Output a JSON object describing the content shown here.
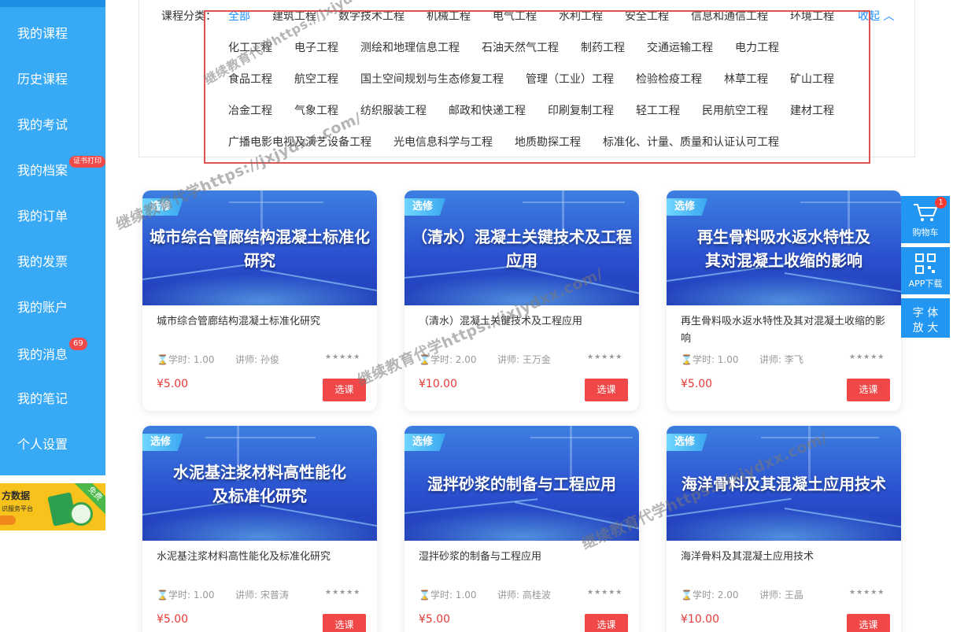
{
  "sidebar": {
    "items": [
      {
        "label": "我的课程"
      },
      {
        "label": "历史课程"
      },
      {
        "label": "我的考试"
      },
      {
        "label": "我的档案",
        "badge": "证书打印"
      },
      {
        "label": "我的订单"
      },
      {
        "label": "我的发票"
      },
      {
        "label": "我的账户"
      },
      {
        "label": "我的消息",
        "badge": "69"
      },
      {
        "label": "我的笔记"
      },
      {
        "label": "个人设置"
      }
    ],
    "promo": {
      "title": "方数据",
      "subtitle": "识服务平台",
      "ribbon": "免费"
    }
  },
  "filter": {
    "label": "课程分类：",
    "collapse_label": "收起",
    "row0": [
      "全部",
      "建筑工程",
      "数字技术工程",
      "机械工程",
      "电气工程",
      "水利工程",
      "安全工程",
      "信息和通信工程",
      "环境工程"
    ],
    "row1": [
      "化工工程",
      "电子工程",
      "测绘和地理信息工程",
      "石油天然气工程",
      "制药工程",
      "交通运输工程",
      "电力工程"
    ],
    "row2": [
      "食品工程",
      "航空工程",
      "国土空间规划与生态修复工程",
      "管理（工业）工程",
      "检验检疫工程",
      "林草工程",
      "矿山工程"
    ],
    "row3": [
      "冶金工程",
      "气象工程",
      "纺织服装工程",
      "邮政和快递工程",
      "印刷复制工程",
      "轻工工程",
      "民用航空工程",
      "建材工程"
    ],
    "row4": [
      "广播电影电视及演艺设备工程",
      "光电信息科学与工程",
      "地质勘探工程",
      "标准化、计量、质量和认证认可工程"
    ]
  },
  "courses": [
    {
      "tag": "选修",
      "banner_title": "城市综合管廊结构混凝土标准化研究",
      "title": "城市综合管廊结构混凝土标准化研究",
      "hours": "学时: 1.00",
      "teacher": "讲师: 孙俊",
      "stars": "★★★★★",
      "price": "¥5.00",
      "button": "选课"
    },
    {
      "tag": "选修",
      "banner_title": "（清水）混凝土关键技术及工程应用",
      "title": "（清水）混凝土关键技术及工程应用",
      "hours": "学时: 2.00",
      "teacher": "讲师: 王万金",
      "stars": "★★★★★",
      "price": "¥10.00",
      "button": "选课"
    },
    {
      "tag": "选修",
      "banner_title": "再生骨料吸水返水特性及其对混凝土收缩的影响",
      "title": "再生骨料吸水返水特性及其对混凝土收缩的影响",
      "hours": "学时: 1.00",
      "teacher": "讲师: 李飞",
      "stars": "★★★★★",
      "price": "¥5.00",
      "button": "选课"
    },
    {
      "tag": "选修",
      "banner_title": "水泥基注浆材料高性能化及标准化研究",
      "title": "水泥基注浆材料高性能化及标准化研究",
      "hours": "学时: 1.00",
      "teacher": "讲师: 宋普涛",
      "stars": "★★★★★",
      "price": "¥5.00",
      "button": "选课"
    },
    {
      "tag": "选修",
      "banner_title": "湿拌砂浆的制备与工程应用",
      "title": "湿拌砂浆的制备与工程应用",
      "hours": "学时: 1.00",
      "teacher": "讲师: 高桂波",
      "stars": "★★★★★",
      "price": "¥5.00",
      "button": "选课"
    },
    {
      "tag": "选修",
      "banner_title": "海洋骨料及其混凝土应用技术",
      "title": "海洋骨料及其混凝土应用技术",
      "hours": "学时: 2.00",
      "teacher": "讲师: 王晶",
      "stars": "★★★★★",
      "price": "¥10.00",
      "button": "选课"
    }
  ],
  "float_tools": {
    "cart_label": "购物车",
    "cart_count": "1",
    "app_label": "APP下载",
    "font_label_1": "字 体",
    "font_label_2": "放 大"
  },
  "watermarks": [
    "继续教育代学https://jxjydxx.com/",
    "继续教育代学https://jxjydxx.com/",
    "继续教育代学https://jxjydxx.com/",
    "继续教育代学https://jxjydxx.com/"
  ]
}
